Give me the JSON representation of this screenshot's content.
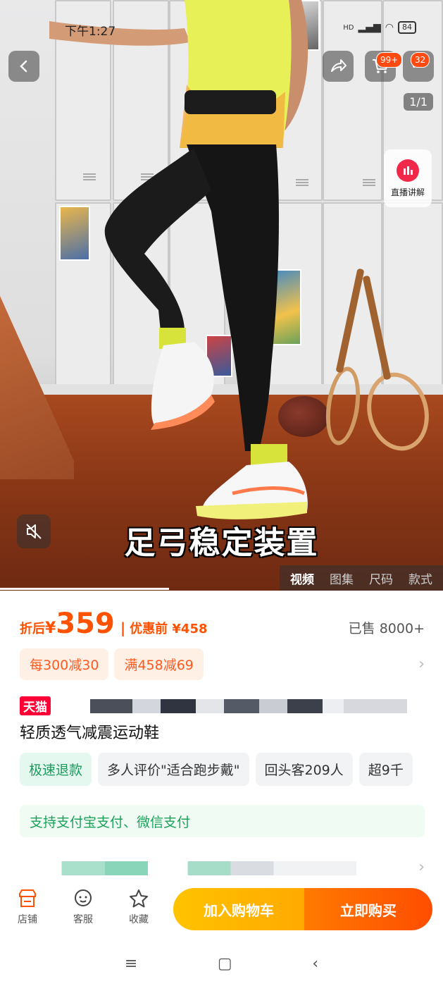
{
  "status_bar": {
    "time": "下午1:27",
    "network": "HD",
    "battery": "84"
  },
  "media": {
    "cart_badge": "99+",
    "message_badge": "32",
    "image_counter": "1/1",
    "live_explain_label": "直播讲解",
    "caption": "足弓稳定装置",
    "tabs": [
      "视频",
      "图集",
      "尺码",
      "款式"
    ],
    "active_tab": "视频"
  },
  "price": {
    "after_label": "折后",
    "currency": "¥",
    "amount": "359",
    "separator": "|",
    "before_label": "优惠前 ¥458",
    "sold": "已售 8000+"
  },
  "coupons": [
    "每300减30",
    "满458减69"
  ],
  "title": {
    "store_badge": "天猫",
    "product_name": "轻质透气减震运动鞋"
  },
  "tags": [
    "极速退款",
    "多人评价\"适合跑步戴\"",
    "回头客209人",
    "超9千"
  ],
  "payment_note": "支持支付宝支付、微信支付",
  "bottom_bar": {
    "shop_label": "店铺",
    "service_label": "客服",
    "favorite_label": "收藏",
    "add_cart_label": "加入购物车",
    "buy_now_label": "立即购买"
  },
  "colors": {
    "accent": "#ff5200",
    "tmall": "#ff0036",
    "green": "#1aa25a"
  }
}
